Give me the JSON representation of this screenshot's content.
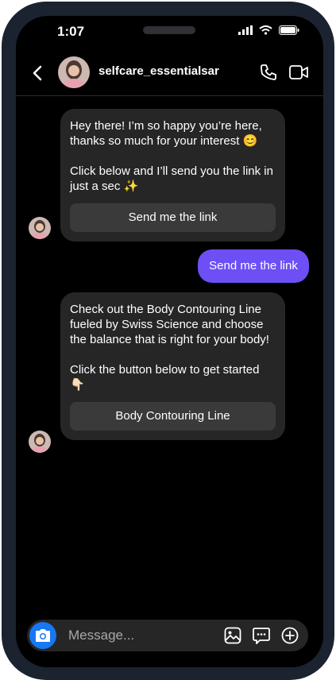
{
  "status": {
    "time": "1:07"
  },
  "header": {
    "username": "selfcare_essentialsar"
  },
  "messages": [
    {
      "direction": "incoming",
      "text": "Hey there! I’m so happy you’re here, thanks so much for your interest 😊\n\nClick below and I’ll send you the link in just a sec ✨",
      "button": "Send me the link"
    },
    {
      "direction": "outgoing",
      "text": "Send me the link"
    },
    {
      "direction": "incoming",
      "text": "Check out the Body Contouring Line fueled by Swiss Science and choose the balance that is right for your body!\n\nClick the button below to get started 👇🏻",
      "button": "Body Contouring Line"
    }
  ],
  "composer": {
    "placeholder": "Message..."
  },
  "colors": {
    "outgoing_bubble": "#6d4ff5",
    "incoming_bubble": "#262626",
    "camera_button": "#1877f2"
  }
}
